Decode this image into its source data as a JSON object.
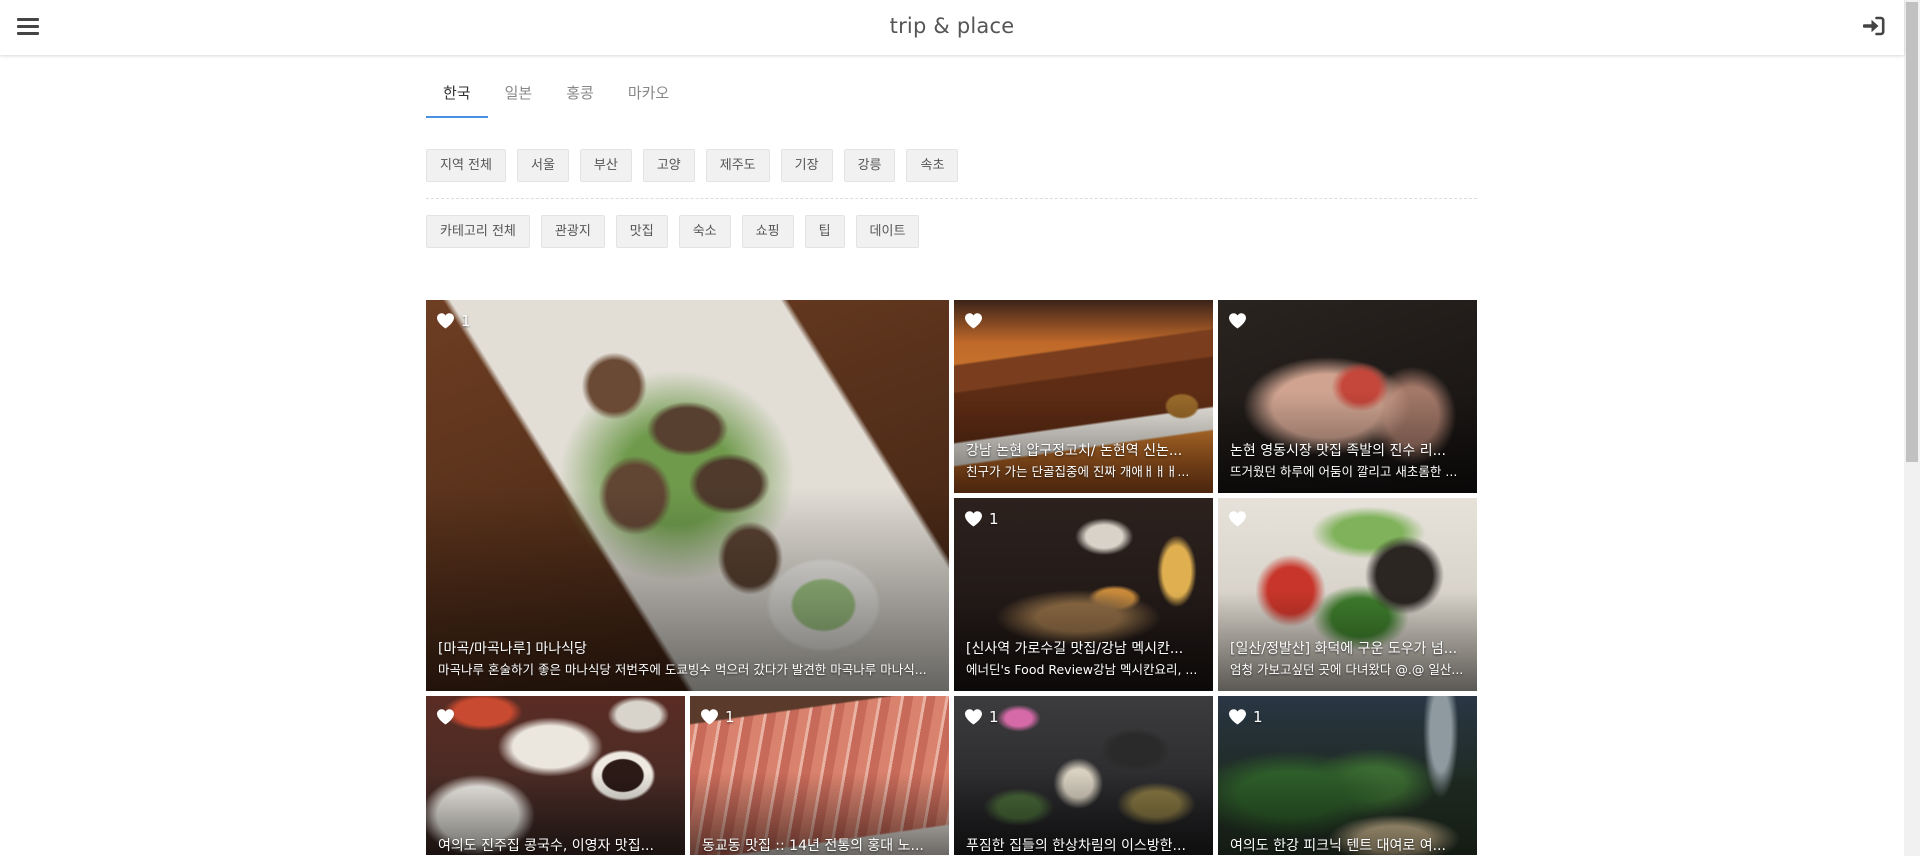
{
  "header": {
    "title": "trip & place",
    "menu_icon": "hamburger-menu-icon",
    "login_icon": "sign-in-icon"
  },
  "tabs": [
    {
      "label": "한국",
      "active": true
    },
    {
      "label": "일본",
      "active": false
    },
    {
      "label": "홍콩",
      "active": false
    },
    {
      "label": "마카오",
      "active": false
    }
  ],
  "region_filters": [
    "지역 전체",
    "서울",
    "부산",
    "고양",
    "제주도",
    "기장",
    "강릉",
    "속초"
  ],
  "category_filters": [
    "카테고리 전체",
    "관광지",
    "맛집",
    "숙소",
    "쇼핑",
    "팁",
    "데이트"
  ],
  "like_icon": "heart-icon",
  "posts": [
    {
      "title": "[마곡/마곡나루] 마나식당",
      "excerpt": "마곡나루 혼술하기 좋은 마나식당 저번주에 도쿄빙수 먹으러 갔다가 발견한 마곡나루 마나식...",
      "likes": 1
    },
    {
      "title": "강남 논현 압구정고치/ 논현역 신논...",
      "excerpt": "친구가 가는 단골집중에 진짜 개애ㅐㅐㅐ..."
    },
    {
      "title": "논현 영동시장 맛집 족발의 진수 리...",
      "excerpt": "뜨거웠던 하루에 어둠이 깔리고 새초롬한 ..."
    },
    {
      "title": "[신사역 가로수길 맛집/강남 멕시칸...",
      "excerpt": "에너딘's Food Review강남 멕시칸요리, ...",
      "likes": 1
    },
    {
      "title": "[일산/정발산] 화덕에 구운 도우가 넘...",
      "excerpt": "엄청 가보고싶던 곳에 다녀왔다 @.@ 일산..."
    },
    {
      "title": "여의도 진주집 콩국수, 이영자 맛집..."
    },
    {
      "title": "동교동 맛집 :: 14년 전통의 홍대 노...",
      "likes": 1
    },
    {
      "title": "푸짐한 집들의 한상차림의 이스방한...",
      "likes": 1
    },
    {
      "title": "여의도 한강 피크닉 텐트 대여로 여...",
      "likes": 1
    }
  ],
  "colors": {
    "accent": "#4a90e2",
    "chip_background": "#f1f1f1",
    "header_text": "#555555"
  }
}
